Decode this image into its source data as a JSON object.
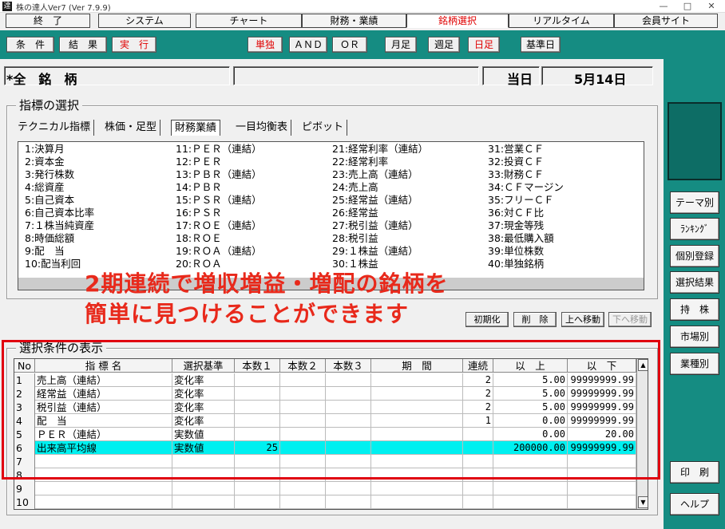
{
  "app": {
    "title": "株の達人Ver7 (Ver 7.9.9)",
    "icon_char": "達"
  },
  "window_controls": {
    "minimize": "—",
    "maximize": "□",
    "close": "✕"
  },
  "menu_tabs": [
    {
      "label": "終　了"
    },
    {
      "label": "システム"
    },
    {
      "label": "チャート"
    },
    {
      "label": "財務・業績"
    },
    {
      "label": "銘柄選択"
    },
    {
      "label": "リアルタイム"
    },
    {
      "label": "会員サイト"
    }
  ],
  "toolbar": {
    "buttons": [
      {
        "label": "条　件"
      },
      {
        "label": "結　果"
      },
      {
        "label": "実　行"
      },
      {
        "label": "単独"
      },
      {
        "label": "ＡＮＤ"
      },
      {
        "label": "ＯＲ"
      },
      {
        "label": "月足"
      },
      {
        "label": "週足"
      },
      {
        "label": "日足"
      },
      {
        "label": "基準日"
      }
    ]
  },
  "stock": {
    "name": "*全　銘　柄",
    "extra": "",
    "date_label": "当日",
    "date_value": "5月14日"
  },
  "indicator_section": {
    "title": "指標の選択",
    "tabs": [
      {
        "label": "テクニカル指標"
      },
      {
        "label": "株価・足型"
      },
      {
        "label": "財務業績"
      },
      {
        "label": "一目均衡表"
      },
      {
        "label": "ピボット"
      }
    ],
    "columns": [
      [
        "1:決算月",
        "2:資本金",
        "3:発行株数",
        "4:総資産",
        "5:自己資本",
        "6:自己資本比率",
        "7:１株当純資産",
        "8:時価総額",
        "9:配　当",
        "10:配当利回"
      ],
      [
        "11:ＰＥＲ（連結）",
        "12:ＰＥＲ",
        "13:ＰＢＲ（連結）",
        "14:ＰＢＲ",
        "15:ＰＳＲ（連結）",
        "16:ＰＳＲ",
        "17:ＲＯＥ（連結）",
        "18:ＲＯＥ",
        "19:ＲＯＡ（連結）",
        "20:ＲＯＡ"
      ],
      [
        "21:経常利率（連結）",
        "22:経常利率",
        "23:売上高（連結）",
        "24:売上高",
        "25:経常益（連結）",
        "26:経常益",
        "27:税引益（連結）",
        "28:税引益",
        "29:１株益（連結）",
        "30:１株益"
      ],
      [
        "31:営業ＣＦ",
        "32:投資ＣＦ",
        "33:財務ＣＦ",
        "34:ＣＦマージン",
        "35:フリーＣＦ",
        "36:対ＣＦ比",
        "37:現金等残",
        "38:最低購入額",
        "39:単位株数",
        "40:単独銘柄"
      ]
    ]
  },
  "overlay_text": {
    "line1": "2期連続で増収増益・増配の銘柄を",
    "line2": "簡単に見つけることができます"
  },
  "action_buttons": [
    {
      "label": "初期化"
    },
    {
      "label": "削　除"
    },
    {
      "label": "上へ移動"
    },
    {
      "label": "下へ移動"
    }
  ],
  "conditions": {
    "title": "選択条件の表示",
    "headers": [
      "No",
      "指 標 名",
      "選択基準",
      "本数１",
      "本数２",
      "本数３",
      "期　間",
      "連続",
      "以　上",
      "以　下"
    ],
    "rows": [
      {
        "no": "1",
        "name": "売上高（連結）",
        "basis": "変化率",
        "n1": "",
        "n2": "",
        "n3": "",
        "period": "",
        "cont": "2",
        "min": "5.00",
        "max": "99999999.99",
        "highlight": false
      },
      {
        "no": "2",
        "name": "経常益（連結）",
        "basis": "変化率",
        "n1": "",
        "n2": "",
        "n3": "",
        "period": "",
        "cont": "2",
        "min": "5.00",
        "max": "99999999.99",
        "highlight": false
      },
      {
        "no": "3",
        "name": "税引益（連結）",
        "basis": "変化率",
        "n1": "",
        "n2": "",
        "n3": "",
        "period": "",
        "cont": "2",
        "min": "5.00",
        "max": "99999999.99",
        "highlight": false
      },
      {
        "no": "4",
        "name": "配　当",
        "basis": "変化率",
        "n1": "",
        "n2": "",
        "n3": "",
        "period": "",
        "cont": "1",
        "min": "0.00",
        "max": "99999999.99",
        "highlight": false
      },
      {
        "no": "5",
        "name": "ＰＥＲ（連結）",
        "basis": "実数値",
        "n1": "",
        "n2": "",
        "n3": "",
        "period": "",
        "cont": "",
        "min": "0.00",
        "max": "20.00",
        "highlight": false
      },
      {
        "no": "6",
        "name": "出来高平均線",
        "basis": "実数値",
        "n1": "25",
        "n2": "",
        "n3": "",
        "period": "",
        "cont": "",
        "min": "200000.00",
        "max": "99999999.99",
        "highlight": true
      },
      {
        "no": "7",
        "name": "",
        "basis": "",
        "n1": "",
        "n2": "",
        "n3": "",
        "period": "",
        "cont": "",
        "min": "",
        "max": "",
        "highlight": false
      },
      {
        "no": "8",
        "name": "",
        "basis": "",
        "n1": "",
        "n2": "",
        "n3": "",
        "period": "",
        "cont": "",
        "min": "",
        "max": "",
        "highlight": false
      },
      {
        "no": "9",
        "name": "",
        "basis": "",
        "n1": "",
        "n2": "",
        "n3": "",
        "period": "",
        "cont": "",
        "min": "",
        "max": "",
        "highlight": false
      },
      {
        "no": "10",
        "name": "",
        "basis": "",
        "n1": "",
        "n2": "",
        "n3": "",
        "period": "",
        "cont": "",
        "min": "",
        "max": "",
        "highlight": false
      }
    ]
  },
  "side_buttons": [
    {
      "label": "テーマ別"
    },
    {
      "label": "ﾗﾝｷﾝｸﾞ"
    },
    {
      "label": "個別登録"
    },
    {
      "label": "選択結果"
    },
    {
      "label": "持　株"
    },
    {
      "label": "市場別"
    },
    {
      "label": "業種別"
    },
    {
      "label": "印　刷"
    },
    {
      "label": "ヘルプ"
    }
  ],
  "colors": {
    "teal": "#158c82",
    "accent_red": "#e00000",
    "highlight_row": "#00f0f0",
    "overlay_red": "#e8291b"
  }
}
